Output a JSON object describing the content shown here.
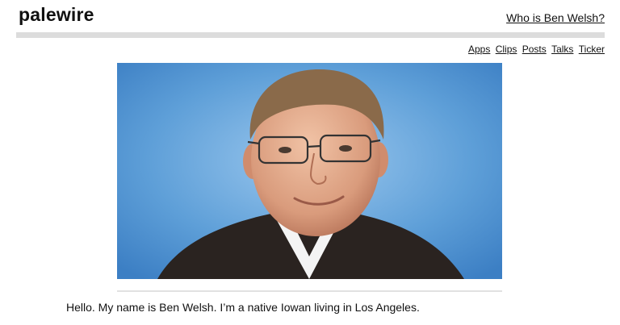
{
  "site": {
    "brand": "palewire",
    "about_link": "Who is Ben Welsh?"
  },
  "subnav": {
    "items": [
      {
        "label": "Apps"
      },
      {
        "label": "Clips"
      },
      {
        "label": "Posts"
      },
      {
        "label": "Talks"
      },
      {
        "label": "Ticker"
      }
    ]
  },
  "photo": {
    "icon": "portrait-photo",
    "background_color": "#5b9fd6"
  },
  "intro": {
    "text": "Hello. My name is Ben Welsh. I’m a native Iowan living in Los Angeles."
  }
}
